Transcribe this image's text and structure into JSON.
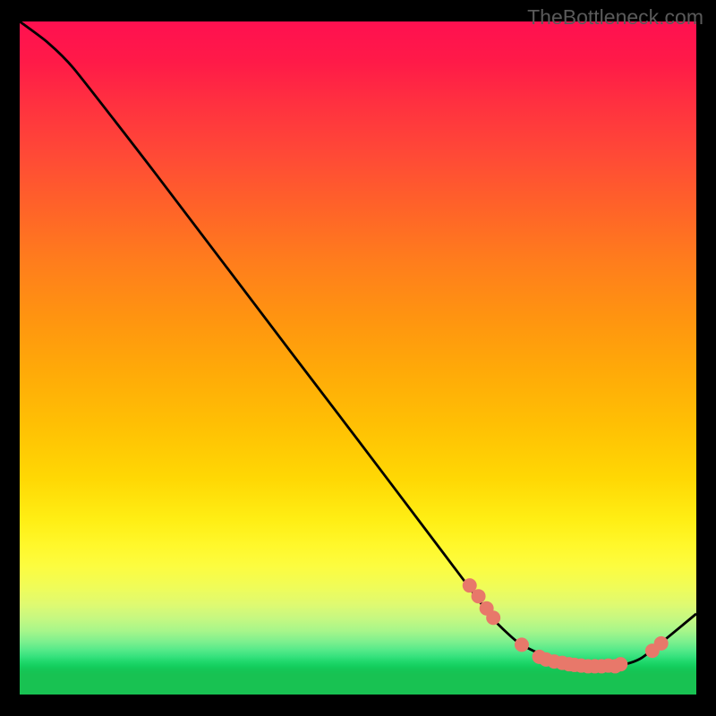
{
  "watermark": "TheBottleneck.com",
  "chart_data": {
    "type": "line",
    "title": "",
    "xlabel": "",
    "ylabel": "",
    "xlim": [
      0,
      100
    ],
    "ylim": [
      0,
      100
    ],
    "grid": false,
    "legend": false,
    "series": [
      {
        "name": "bottleneck-curve",
        "x": [
          0,
          4,
          8,
          20,
          40,
          50,
          60,
          66,
          70,
          74,
          80,
          84,
          88,
          92,
          100
        ],
        "y": [
          100,
          97,
          93,
          77.5,
          51,
          37.8,
          24.5,
          16.5,
          11.2,
          7.5,
          4.7,
          4.2,
          4.2,
          5.5,
          12
        ]
      }
    ],
    "markers": [
      {
        "x": 66.5,
        "y": 16.2
      },
      {
        "x": 67.8,
        "y": 14.6
      },
      {
        "x": 69,
        "y": 12.8
      },
      {
        "x": 70,
        "y": 11.4
      },
      {
        "x": 74.2,
        "y": 7.4
      },
      {
        "x": 76.8,
        "y": 5.6
      },
      {
        "x": 77.8,
        "y": 5.2
      },
      {
        "x": 79,
        "y": 4.9
      },
      {
        "x": 80.2,
        "y": 4.7
      },
      {
        "x": 81.2,
        "y": 4.5
      },
      {
        "x": 82,
        "y": 4.4
      },
      {
        "x": 83,
        "y": 4.3
      },
      {
        "x": 84,
        "y": 4.2
      },
      {
        "x": 85,
        "y": 4.2
      },
      {
        "x": 86,
        "y": 4.2
      },
      {
        "x": 87,
        "y": 4.3
      },
      {
        "x": 88,
        "y": 4.2
      },
      {
        "x": 88.8,
        "y": 4.5
      },
      {
        "x": 93.5,
        "y": 6.5
      },
      {
        "x": 94.8,
        "y": 7.6
      }
    ],
    "marker_style": {
      "color": "#e8786a",
      "radius": 8
    },
    "background": "rainbow-gradient-vertical"
  }
}
